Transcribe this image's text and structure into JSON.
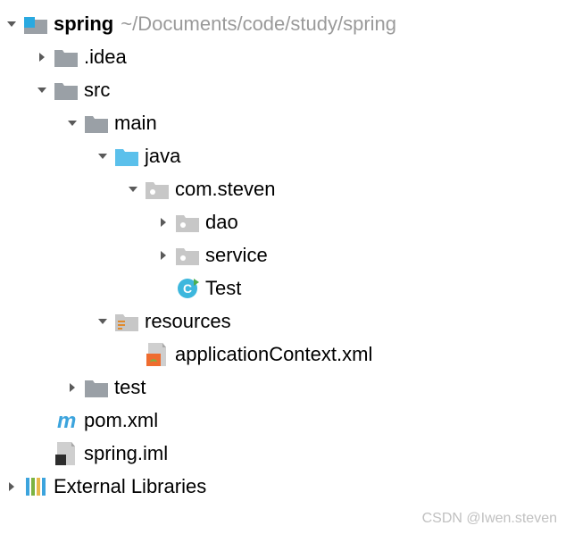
{
  "root": {
    "name": "spring",
    "path": "~/Documents/code/study/spring"
  },
  "nodes": {
    "idea": ".idea",
    "src": "src",
    "main": "main",
    "java": "java",
    "com_steven": "com.steven",
    "dao": "dao",
    "service": "service",
    "test_class": "Test",
    "resources": "resources",
    "appctx": "applicationContext.xml",
    "test_dir": "test",
    "pom": "pom.xml",
    "spring_iml": "spring.iml",
    "ext_lib": "External Libraries"
  },
  "watermark": "CSDN @Iwen.steven"
}
